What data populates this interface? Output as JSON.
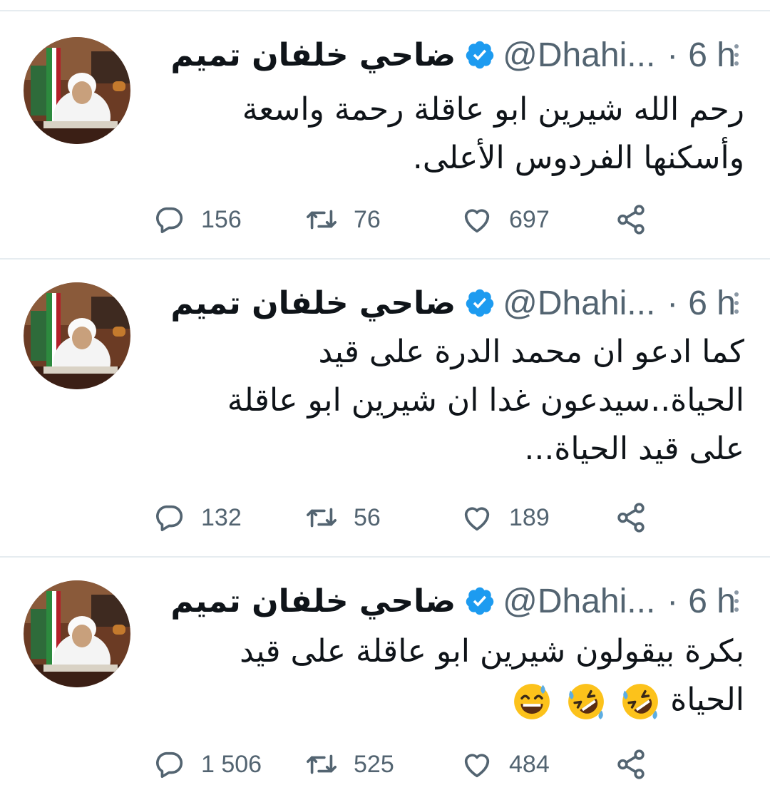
{
  "tweets": [
    {
      "display_name": "ضاحي خلفان تميم",
      "handle": "@Dhahi...",
      "separator": "·",
      "time": "6 h",
      "text_lines": [
        "رحم الله شيرين ابو عاقلة رحمة واسعة",
        "وأسكنها الفردوس الأعلى."
      ],
      "emoji": [],
      "replies": "156",
      "retweets": "76",
      "likes": "697"
    },
    {
      "display_name": "ضاحي خلفان تميم",
      "handle": "@Dhahi...",
      "separator": "·",
      "time": "6 h",
      "text_lines": [
        "كما ادعو ان محمد الدرة على قيد",
        "الحياة..سيدعون غدا ان شيرين ابو عاقلة",
        "على قيد الحياة..."
      ],
      "emoji": [],
      "replies": "132",
      "retweets": "56",
      "likes": "189"
    },
    {
      "display_name": "ضاحي خلفان تميم",
      "handle": "@Dhahi...",
      "separator": "·",
      "time": "6 h",
      "text_lines": [
        "بكرة بيقولون شيرين ابو عاقلة على قيد",
        "الحياة"
      ],
      "emoji": [
        "rolling-on-floor-laughing",
        "rolling-on-floor-laughing",
        "grinning-sweat"
      ],
      "replies": "1 506",
      "retweets": "525",
      "likes": "484"
    }
  ],
  "icons": {
    "reply": "reply-icon",
    "retweet": "retweet-icon",
    "like": "heart-icon",
    "share": "share-icon",
    "verified": "verified-badge-icon",
    "more": "more-vertical-icon"
  },
  "colors": {
    "verified": "#1d9bf0",
    "secondary_text": "#536471",
    "primary_text": "#0f1419",
    "divider": "#e6ecf0"
  }
}
